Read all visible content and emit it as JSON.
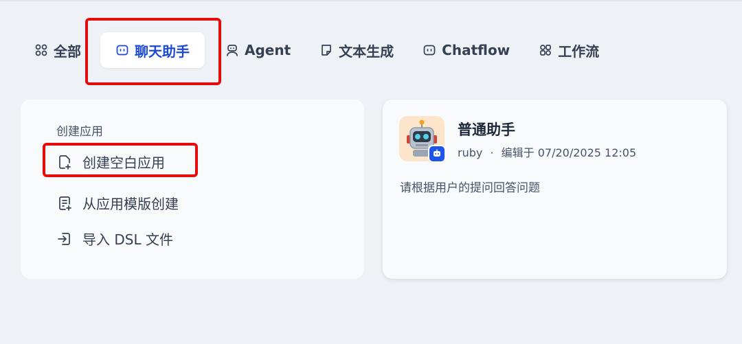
{
  "tabs": [
    {
      "label": "全部",
      "icon": "grid-icon"
    },
    {
      "label": "聊天助手",
      "icon": "chat-bot-icon",
      "active": true
    },
    {
      "label": "Agent",
      "icon": "agent-robot-icon"
    },
    {
      "label": "文本生成",
      "icon": "document-icon"
    },
    {
      "label": "Chatflow",
      "icon": "chatflow-icon"
    },
    {
      "label": "工作流",
      "icon": "workflow-icon"
    }
  ],
  "create": {
    "title": "创建应用",
    "blank_label": "创建空白应用",
    "template_label": "从应用模版创建",
    "import_label": "导入 DSL 文件"
  },
  "app": {
    "name": "普通助手",
    "author": "ruby",
    "separator": "·",
    "edited_prefix": "编辑于",
    "edited_time": "07/20/2025 12:05",
    "description": "请根据用户的提问回答问题",
    "avatar_icon": "robot-emoji-icon",
    "badge_icon": "chat-bot-icon"
  },
  "colors": {
    "accent": "#1c48d6",
    "highlight": "#e60a0a",
    "avatar_bg": "#fde5cc",
    "badge_bg": "#1f54e8"
  }
}
